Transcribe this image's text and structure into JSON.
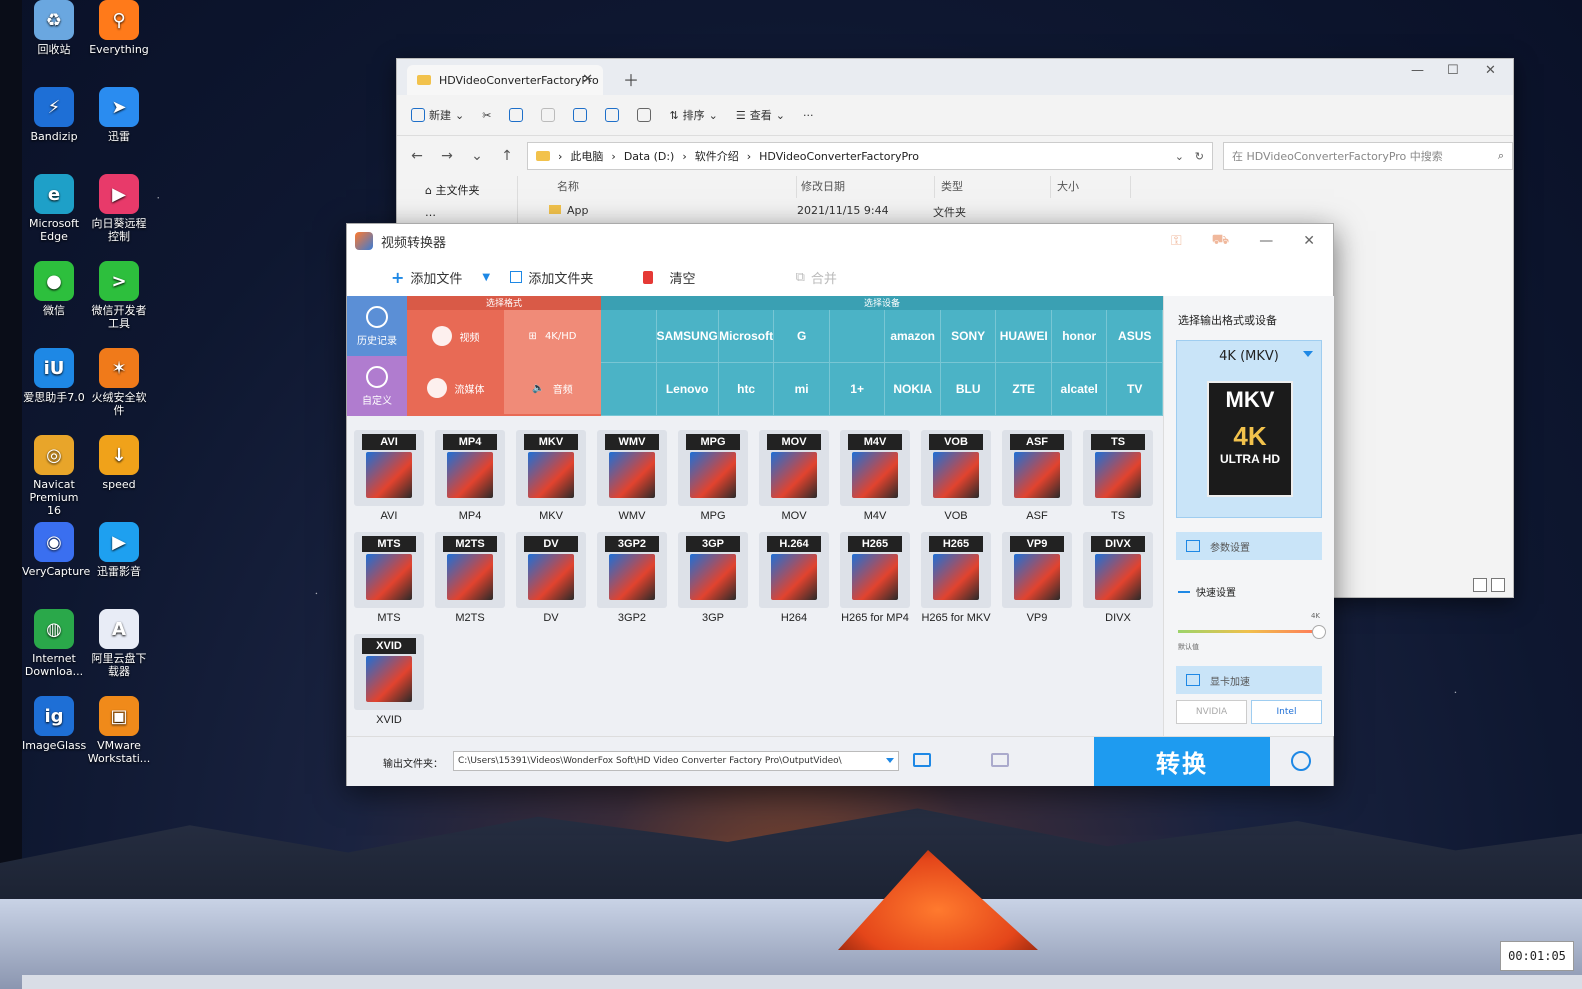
{
  "desktop": {
    "icons": [
      {
        "label": "回收站",
        "icon": "recycle-bin-icon",
        "color": "#6aa7e0",
        "glyph": "♻"
      },
      {
        "label": "Everything",
        "icon": "search-icon",
        "color": "#ff7a1a",
        "glyph": "⚲"
      },
      {
        "label": "Bandizip",
        "icon": "bandizip-icon",
        "color": "#1e6fd6",
        "glyph": "⚡"
      },
      {
        "label": "迅雷",
        "icon": "thunder-bird-icon",
        "color": "#2a8cf0",
        "glyph": "➤"
      },
      {
        "label": "Microsoft Edge",
        "icon": "edge-icon",
        "color": "#1ea0c8",
        "glyph": "e"
      },
      {
        "label": "向日葵远程控制",
        "icon": "sunlogin-icon",
        "color": "#e83a6a",
        "glyph": "▶"
      },
      {
        "label": "微信",
        "icon": "wechat-icon",
        "color": "#2dbf3d",
        "glyph": "●"
      },
      {
        "label": "微信开发者工具",
        "icon": "wechat-dev-icon",
        "color": "#2dbf3d",
        "glyph": ">"
      },
      {
        "label": "爱思助手7.0",
        "icon": "i4-icon",
        "color": "#1e88e5",
        "glyph": "iU"
      },
      {
        "label": "火绒安全软件",
        "icon": "huorong-icon",
        "color": "#f07a1a",
        "glyph": "✶"
      },
      {
        "label": "Navicat Premium 16",
        "icon": "navicat-icon",
        "color": "#e8a52a",
        "glyph": "◎"
      },
      {
        "label": "speed",
        "icon": "download-icon",
        "color": "#f0a21a",
        "glyph": "↓"
      },
      {
        "label": "VeryCapture",
        "icon": "panda-icon",
        "color": "#3a6ff0",
        "glyph": "◉"
      },
      {
        "label": "迅雷影音",
        "icon": "player-icon",
        "color": "#1ea0f0",
        "glyph": "▶"
      },
      {
        "label": "Internet Downloa...",
        "icon": "globe-icon",
        "color": "#2aa84a",
        "glyph": "◍"
      },
      {
        "label": "阿里云盘下载器",
        "icon": "aliyun-icon",
        "color": "#e8ecf6",
        "glyph": "A"
      },
      {
        "label": "ImageGlass",
        "icon": "imageglass-icon",
        "color": "#1e6fd6",
        "glyph": "ig"
      },
      {
        "label": "VMware Workstati...",
        "icon": "vmware-icon",
        "color": "#f08a1a",
        "glyph": "▣"
      }
    ],
    "clock": "00:01:05"
  },
  "explorer": {
    "tab_title": "HDVideoConverterFactoryPro",
    "toolbar": {
      "new": "新建",
      "sort": "排序",
      "view": "查看",
      "more": "···"
    },
    "path": [
      "此电脑",
      "Data (D:)",
      "软件介绍",
      "HDVideoConverterFactoryPro"
    ],
    "search_placeholder": "在 HDVideoConverterFactoryPro 中搜索",
    "sidebar": {
      "home": "主文件夹",
      "item2": "…"
    },
    "columns": {
      "name": "名称",
      "modified": "修改日期",
      "type": "类型",
      "size": "大小"
    },
    "row": {
      "name": "App",
      "date": "2021/11/15 9:44",
      "type": "文件夹"
    }
  },
  "converter": {
    "title": "视频转换器",
    "toolbar": {
      "add_file": "添加文件",
      "add_folder": "添加文件夹",
      "clear": "清空",
      "merge": "合并"
    },
    "left_tabs": {
      "history": "历史记录",
      "custom": "自定义"
    },
    "format_header": "选择格式",
    "device_header": "选择设备",
    "format_buttons": {
      "video": "视频",
      "hd": "4K/HD",
      "web": "流媒体",
      "audio": "音频"
    },
    "devices": [
      "",
      "SAMSUNG",
      "Microsoft",
      "G",
      "",
      "amazon",
      "SONY",
      "HUAWEI",
      "honor",
      "ASUS",
      "",
      "Lenovo",
      "htc",
      "mi",
      "1+",
      "NOKIA",
      "BLU",
      "ZTE",
      "alcatel",
      "TV"
    ],
    "formats": [
      {
        "label": "AVI",
        "name": "AVI"
      },
      {
        "label": "MP4",
        "name": "MP4"
      },
      {
        "label": "MKV",
        "name": "MKV"
      },
      {
        "label": "WMV",
        "name": "WMV"
      },
      {
        "label": "MPG",
        "name": "MPG"
      },
      {
        "label": "MOV",
        "name": "MOV"
      },
      {
        "label": "M4V",
        "name": "M4V"
      },
      {
        "label": "VOB",
        "name": "VOB"
      },
      {
        "label": "ASF",
        "name": "ASF"
      },
      {
        "label": "TS",
        "name": "TS"
      },
      {
        "label": "MTS",
        "name": "MTS"
      },
      {
        "label": "M2TS",
        "name": "M2TS"
      },
      {
        "label": "DV",
        "name": "DV"
      },
      {
        "label": "3GP2",
        "name": "3GP2"
      },
      {
        "label": "3GP",
        "name": "3GP"
      },
      {
        "label": "H.264",
        "name": "H264"
      },
      {
        "label": "H265",
        "name": "H265 for MP4"
      },
      {
        "label": "H265",
        "name": "H265 for MKV"
      },
      {
        "label": "VP9",
        "name": "VP9"
      },
      {
        "label": "DIVX",
        "name": "DIVX"
      },
      {
        "label": "XVID",
        "name": "XVID"
      }
    ],
    "right": {
      "title": "选择输出格式或设备",
      "selected": "4K (MKV)",
      "box_top": "MKV",
      "box_mid": "4K",
      "box_bottom": "ULTRA HD",
      "params": "参数设置",
      "quick": "快速设置",
      "gpu": "显卡加速",
      "nvidia": "NVIDIA",
      "intel": "Intel",
      "slider_level": 1.0,
      "slider_max": "4K",
      "slider_min": "默认值"
    },
    "output_label": "输出文件夹：",
    "output_path": "C:\\Users\\15391\\Videos\\WonderFox Soft\\HD Video Converter Factory Pro\\OutputVideo\\",
    "convert": "转换"
  }
}
